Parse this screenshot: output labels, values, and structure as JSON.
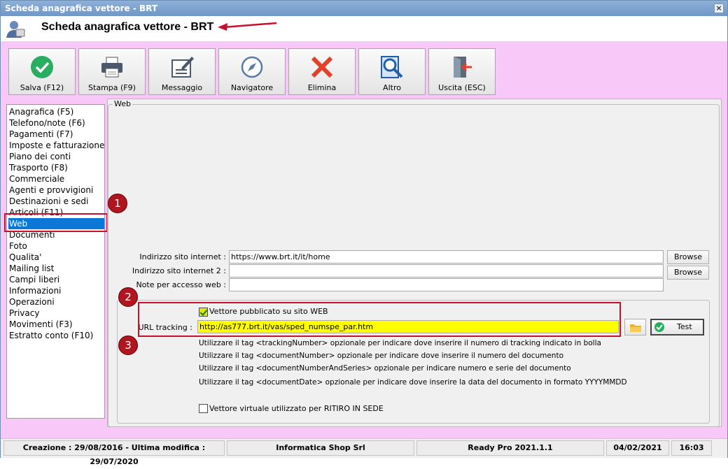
{
  "window": {
    "title": "Scheda anagrafica vettore - BRT",
    "close_label": "×"
  },
  "header": {
    "title": "Scheda anagrafica vettore - BRT"
  },
  "toolbar": {
    "save": "Salva (F12)",
    "print": "Stampa (F9)",
    "message": "Messaggio",
    "navigator": "Navigatore",
    "delete": "Elimina",
    "other": "Altro",
    "exit": "Uscita (ESC)"
  },
  "sidebar": {
    "items": [
      "Anagrafica (F5)",
      "Telefono/note (F6)",
      "Pagamenti (F7)",
      "Imposte e fatturazione",
      "Piano dei conti",
      "Trasporto (F8)",
      "Commerciale",
      "Agenti e provvigioni",
      "Destinazioni e sedi",
      "Articoli (F11)",
      "Web",
      "Documenti",
      "Foto",
      "Qualita'",
      "Mailing list",
      "Campi liberi",
      "Informazioni",
      "Operazioni",
      "Privacy",
      "Movimenti (F3)",
      "Estratto conto (F10)"
    ],
    "selected": "Web"
  },
  "web": {
    "group_label": "Web",
    "site_label": "Indirizzo sito internet :",
    "site_value": "https://www.brt.it/it/home",
    "site2_label": "Indirizzo sito internet 2 :",
    "site2_value": "",
    "notes_label": "Note per accesso web :",
    "notes_value": "",
    "browse": "Browse",
    "published_label": "Vettore pubblicato su sito WEB",
    "published_checked": true,
    "url_label": "URL tracking :",
    "url_value": "http://as777.brt.it/vas/sped_numspe_par.htm",
    "test_label": "Test",
    "info_lines": [
      "Utilizzare il tag <trackingNumber> opzionale per indicare dove inserire il numero di tracking indicato in bolla",
      "Utilizzare il tag <documentNumber> opzionale per indicare dove inserire il numero del documento",
      "Utilizzare il tag <documentNumberAndSeries> opzionale per indicare numero e serie del documento",
      "Utilizzare il tag <documentDate> opzionale per indicare dove inserire la data del documento in formato YYYYMMDD"
    ],
    "virtual_label": "Vettore virtuale utilizzato per RITIRO IN SEDE",
    "virtual_checked": false
  },
  "annotations": {
    "badge1": "1",
    "badge2": "2",
    "badge3": "3"
  },
  "status": {
    "dates": "Creazione : 29/08/2016 - Ultima modifica : 29/07/2020",
    "company": "Informatica Shop Srl",
    "version": "Ready Pro 2021.1.1",
    "date": "04/02/2021",
    "time": "16:03"
  },
  "colors": {
    "accent": "#0b78d7",
    "pink_bg": "#f8c8f8",
    "highlight": "#ffff00",
    "annotation_red": "#c8102e"
  }
}
